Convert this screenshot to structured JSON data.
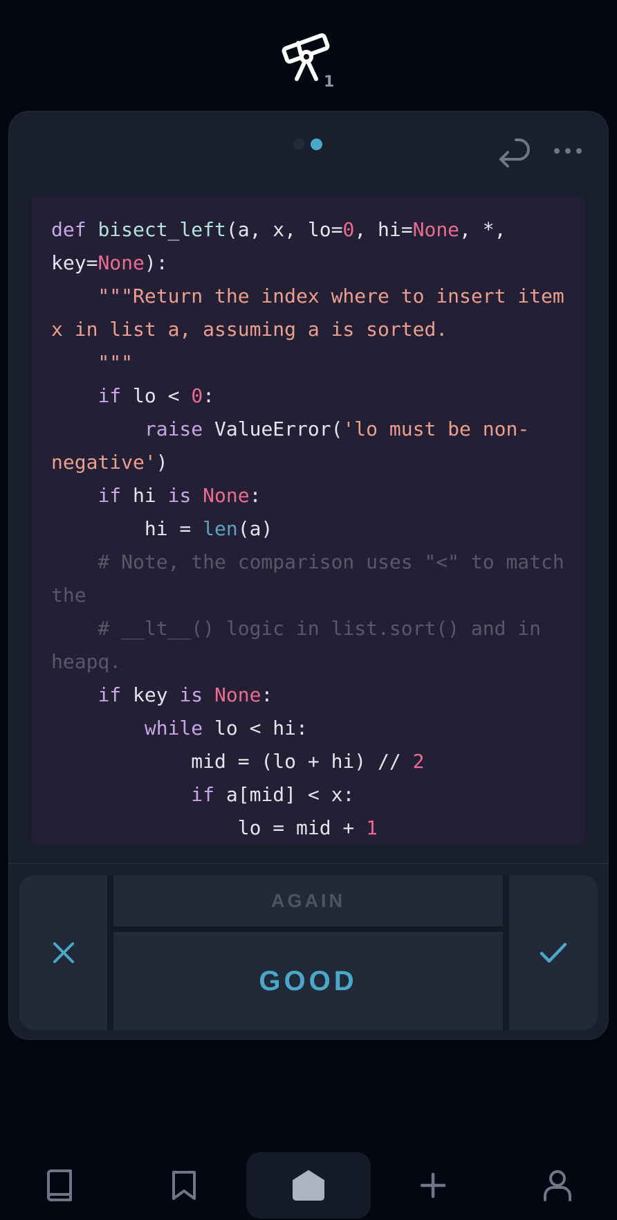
{
  "header": {
    "icon": "telescope-icon",
    "count": "1"
  },
  "card": {
    "pager": {
      "total": 2,
      "active": 2
    },
    "actions": {
      "undo_icon": "undo-arrow-icon",
      "more_icon": "more-dots-icon"
    },
    "code_lines": [
      "def bisect_left(a, x, lo=0, hi=None, *,",
      "key=None):",
      "    \"\"\"Return the index where to insert item",
      "x in list a, assuming a is sorted.",
      "    \"\"\"",
      "    if lo < 0:",
      "        raise ValueError('lo must be non-",
      "negative')",
      "    if hi is None:",
      "        hi = len(a)",
      "    # Note, the comparison uses \"<\" to match",
      "the",
      "    # __lt__() logic in list.sort() and in",
      "heapq.",
      "    if key is None:",
      "        while lo < hi:",
      "            mid = (lo + hi) // 2",
      "            if a[mid] < x:",
      "                lo = mid + 1"
    ]
  },
  "answers": {
    "again_label": "AGAIN",
    "good_label": "GOOD",
    "wrong_icon": "close-x-icon",
    "right_icon": "checkmark-icon"
  },
  "bottom_nav": {
    "items": [
      {
        "icon": "book-icon",
        "active": false
      },
      {
        "icon": "bookmark-icon",
        "active": false
      },
      {
        "icon": "home-icon",
        "active": true
      },
      {
        "icon": "plus-icon",
        "active": false
      },
      {
        "icon": "user-icon",
        "active": false
      }
    ]
  },
  "colors": {
    "background": "#030711",
    "card": "#1a202b",
    "code_background": "#231f34",
    "accent": "#4aa8c8",
    "keyword": "#c7a7e7",
    "function_name": "#b4e2dc",
    "constant": "#ec6b90",
    "string": "#ec9f8e",
    "comment": "#5a5868",
    "builtin": "#5aa3c3"
  }
}
